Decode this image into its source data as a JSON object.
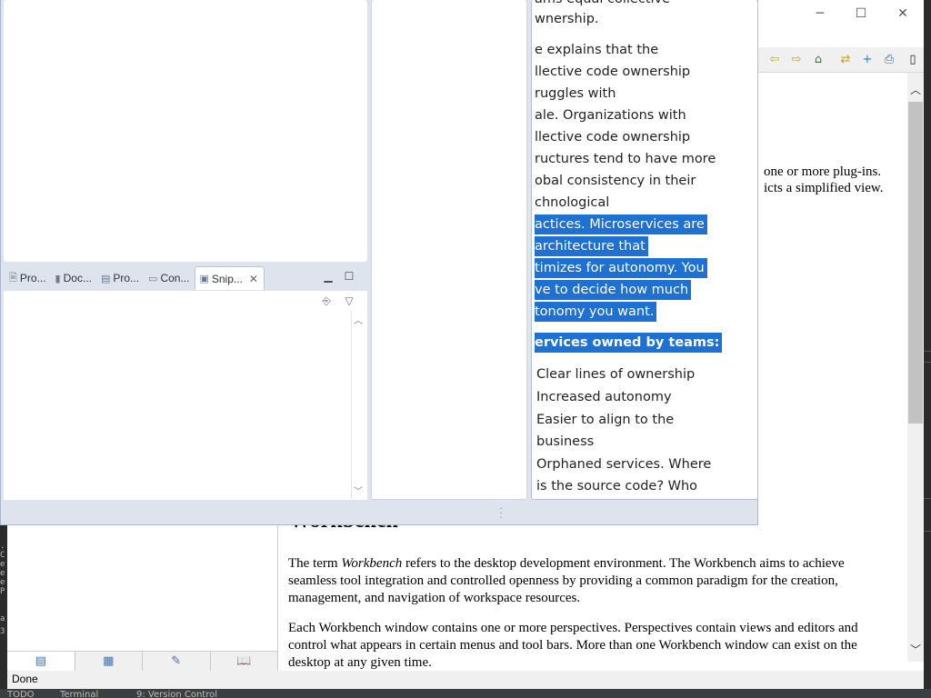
{
  "help_window": {
    "controls": {
      "minimize": "─",
      "maximize": "☐",
      "close": "✕"
    },
    "toolbar_icons": [
      {
        "name": "back-icon",
        "glyph": "⇦",
        "color": "#d6a21c"
      },
      {
        "name": "forward-icon",
        "glyph": "⇨",
        "color": "#d6a21c"
      },
      {
        "name": "home-icon",
        "glyph": "⌂",
        "color": "#3d7a3d"
      },
      {
        "name": "sync-toc-icon",
        "glyph": "⇄",
        "color": "#d6a21c"
      },
      {
        "name": "bookmark-add-icon",
        "glyph": "+",
        "color": "#2a7ad8"
      },
      {
        "name": "print-icon",
        "glyph": "⎙",
        "color": "#2a6ab8"
      },
      {
        "name": "maximize-pane-icon",
        "glyph": "▯",
        "color": "#222222"
      }
    ],
    "clipped_lines": [
      "one or more plug-ins.",
      "icts a simplified view."
    ],
    "heading": "Workbench",
    "paragraph1_pre": "The term ",
    "paragraph1_em": "Workbench",
    "paragraph1_post": " refers to the desktop development environment. The Workbench aims to achieve seamless tool integration and controlled openness by providing a common paradigm for the creation, management, and navigation of workspace resources.",
    "paragraph2": "Each Workbench window contains one or more perspectives.  Perspectives contain views and editors and control what appears in certain menus and tool bars.  More than one Workbench window can exist on the desktop at any given time.",
    "left_tabs": [
      {
        "name": "contents-tab",
        "glyph": "▤"
      },
      {
        "name": "index-tab",
        "glyph": "▦"
      },
      {
        "name": "search-results-tab",
        "glyph": "✎"
      },
      {
        "name": "bookmarks-tab",
        "glyph": "📖"
      }
    ],
    "status": "Done",
    "left_edge_fragments": [
      ". C",
      "e",
      "e",
      "e",
      "P",
      "a",
      "3"
    ]
  },
  "ide_status_bar": {
    "items": [
      "TODO",
      "Terminal",
      "9: Version Control"
    ]
  },
  "eclipse": {
    "view_tabs": [
      {
        "label": "Pro...",
        "icon": "🗎",
        "icon_name": "project-explorer-icon"
      },
      {
        "label": "Doc...",
        "icon": "▮",
        "icon_name": "documentation-icon"
      },
      {
        "label": "Pro...",
        "icon": "▤",
        "icon_name": "properties-icon"
      },
      {
        "label": "Con...",
        "icon": "▭",
        "icon_name": "console-icon"
      },
      {
        "label": "Snip...",
        "icon": "▣",
        "icon_name": "snippets-icon",
        "active": true
      }
    ],
    "tab_close": "✕",
    "minimize": "▁",
    "maximize": "☐",
    "snip_tools": {
      "import": "⎆",
      "menu": "▽"
    },
    "document": {
      "lines_top": [
        "ams equal collective",
        "wnership."
      ],
      "paragraph_lines": [
        "e explains that the",
        "llective code ownership",
        "ruggles with",
        "ale. Organizations with",
        "llective code ownership",
        "ructures tend to have more",
        "obal consistency in their",
        "chnological"
      ],
      "selected_lines": [
        "actices. Microservices are",
        " architecture that",
        "timizes for autonomy. You",
        "ve to decide how much",
        "tonomy you want."
      ],
      "selected_heading": "ervices owned by teams:",
      "list_items": [
        "Clear lines of ownership",
        "Increased autonomy",
        "Easier to align to the",
        "business",
        "Orphaned services. Where",
        "is the source code? Who"
      ]
    }
  },
  "colors": {
    "selection": "#1e70d2",
    "workbench_bg": "#dde4ee"
  }
}
